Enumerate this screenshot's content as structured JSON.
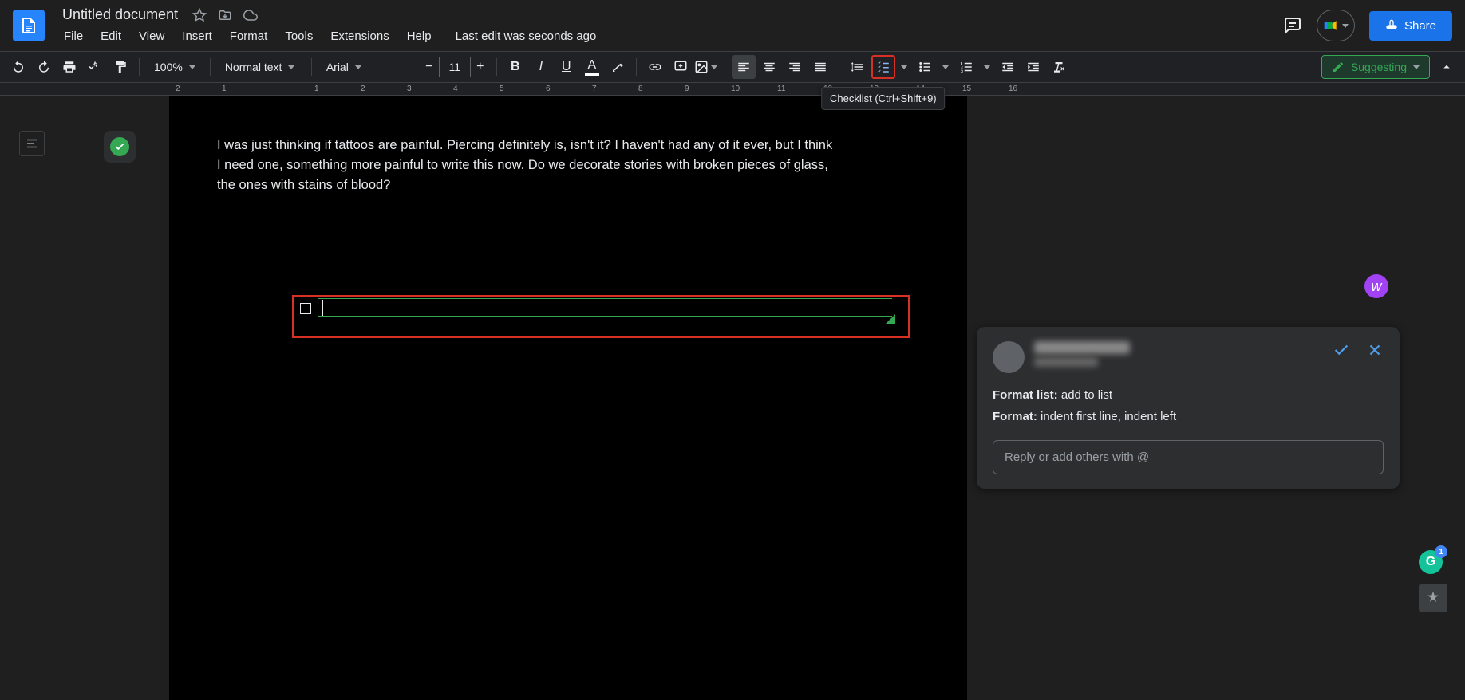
{
  "header": {
    "title": "Untitled document",
    "last_edit": "Last edit was seconds ago",
    "share_label": "Share",
    "menus": [
      "File",
      "Edit",
      "View",
      "Insert",
      "Format",
      "Tools",
      "Extensions",
      "Help"
    ]
  },
  "toolbar": {
    "zoom": "100%",
    "style": "Normal text",
    "font": "Arial",
    "font_size": "11",
    "tooltip": "Checklist (Ctrl+Shift+9)",
    "mode_label": "Suggesting"
  },
  "ruler": {
    "ticks": [
      "2",
      "1",
      "",
      "1",
      "2",
      "3",
      "4",
      "5",
      "6",
      "7",
      "8",
      "9",
      "10",
      "11",
      "12",
      "13",
      "14",
      "15",
      "16"
    ]
  },
  "document": {
    "paragraph": "I was just thinking if tattoos are painful. Piercing definitely is, isn't it? I haven't had any of it ever, but I think I need one, something more painful to write this now. Do we decorate stories with broken pieces of glass, the ones with stains of blood?"
  },
  "suggestion_card": {
    "line1_label": "Format list:",
    "line1_value": " add to list",
    "line2_label": "Format:",
    "line2_value": " indent first line, indent left",
    "reply_placeholder": "Reply or add others with @"
  },
  "grammarly": {
    "count": "1"
  },
  "float_avatar": {
    "letter": "w"
  }
}
